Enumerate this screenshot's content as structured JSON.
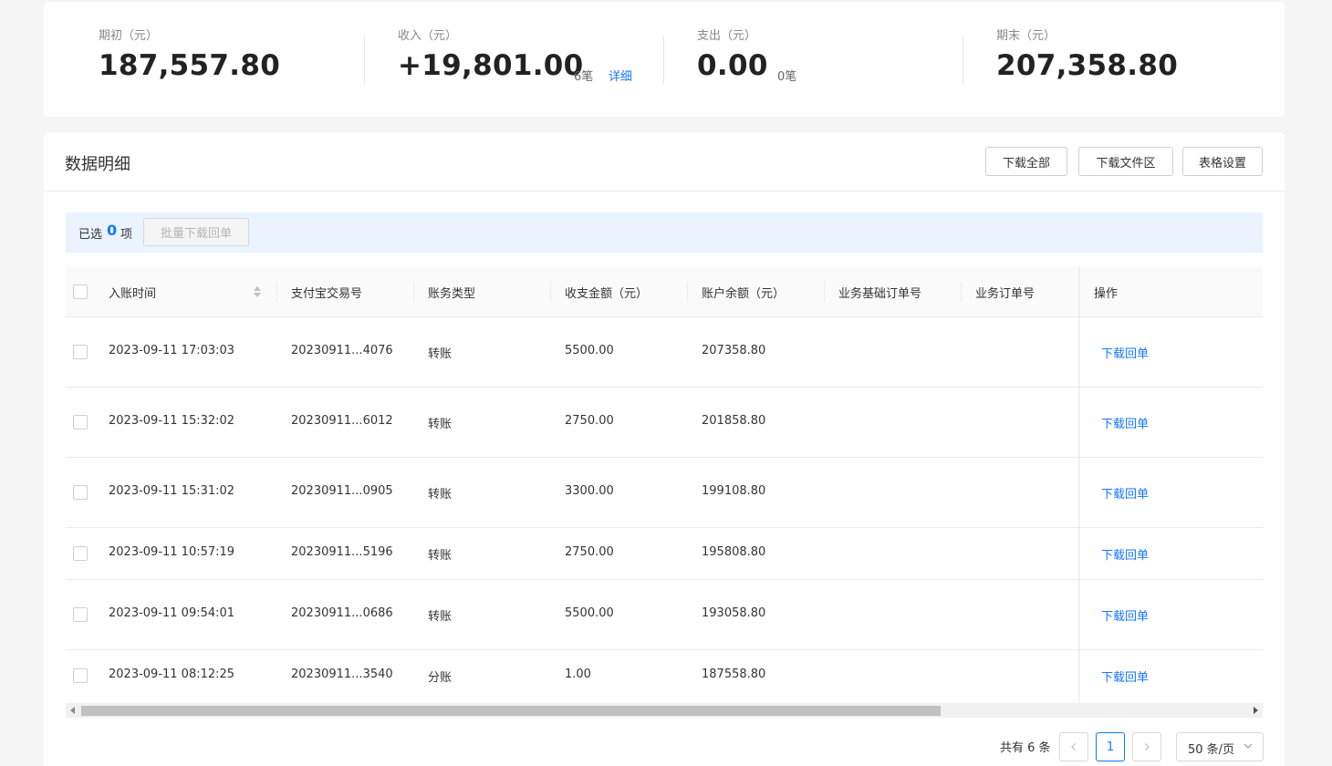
{
  "summary": {
    "opening": {
      "label": "期初（元）",
      "value": "187,557.80"
    },
    "income": {
      "label": "收入（元）",
      "value": "+19,801.00",
      "count": "6笔",
      "detail": "详细"
    },
    "expense": {
      "label": "支出（元）",
      "value": "0.00",
      "count": "0笔"
    },
    "closing": {
      "label": "期末（元）",
      "value": "207,358.80"
    }
  },
  "detail_section": {
    "title": "数据明细",
    "buttons": {
      "download_all": "下载全部",
      "download_files": "下载文件区",
      "table_settings": "表格设置"
    }
  },
  "selection": {
    "prefix": "已选",
    "count": "0",
    "suffix": "项",
    "batch_button": "批量下载回单"
  },
  "table": {
    "columns": [
      "入账时间",
      "支付宝交易号",
      "账务类型",
      "收支金额（元）",
      "账户余额（元）",
      "业务基础订单号",
      "业务订单号",
      "操作"
    ],
    "rows": [
      {
        "time": "2023-09-11 17:03:03",
        "trade_no": "20230911...4076",
        "type": "转账",
        "amount": "5500.00",
        "balance": "207358.80",
        "action": "下载回单"
      },
      {
        "time": "2023-09-11 15:32:02",
        "trade_no": "20230911...6012",
        "type": "转账",
        "amount": "2750.00",
        "balance": "201858.80",
        "action": "下载回单"
      },
      {
        "time": "2023-09-11 15:31:02",
        "trade_no": "20230911...0905",
        "type": "转账",
        "amount": "3300.00",
        "balance": "199108.80",
        "action": "下载回单"
      },
      {
        "time": "2023-09-11 10:57:19",
        "trade_no": "20230911...5196",
        "type": "转账",
        "amount": "2750.00",
        "balance": "195808.80",
        "action": "下载回单"
      },
      {
        "time": "2023-09-11 09:54:01",
        "trade_no": "20230911...0686",
        "type": "转账",
        "amount": "5500.00",
        "balance": "193058.80",
        "action": "下载回单"
      },
      {
        "time": "2023-09-11 08:12:25",
        "trade_no": "20230911...3540",
        "type": "分账",
        "amount": "1.00",
        "balance": "187558.80",
        "action": "下载回单"
      }
    ]
  },
  "pagination": {
    "total": "共有 6 条",
    "current_page": "1",
    "page_size": "50 条/页"
  },
  "colors": {
    "accent": "#1677ff",
    "selection_bg": "#eaf3ff",
    "page_bg": "#f5f5f5"
  }
}
